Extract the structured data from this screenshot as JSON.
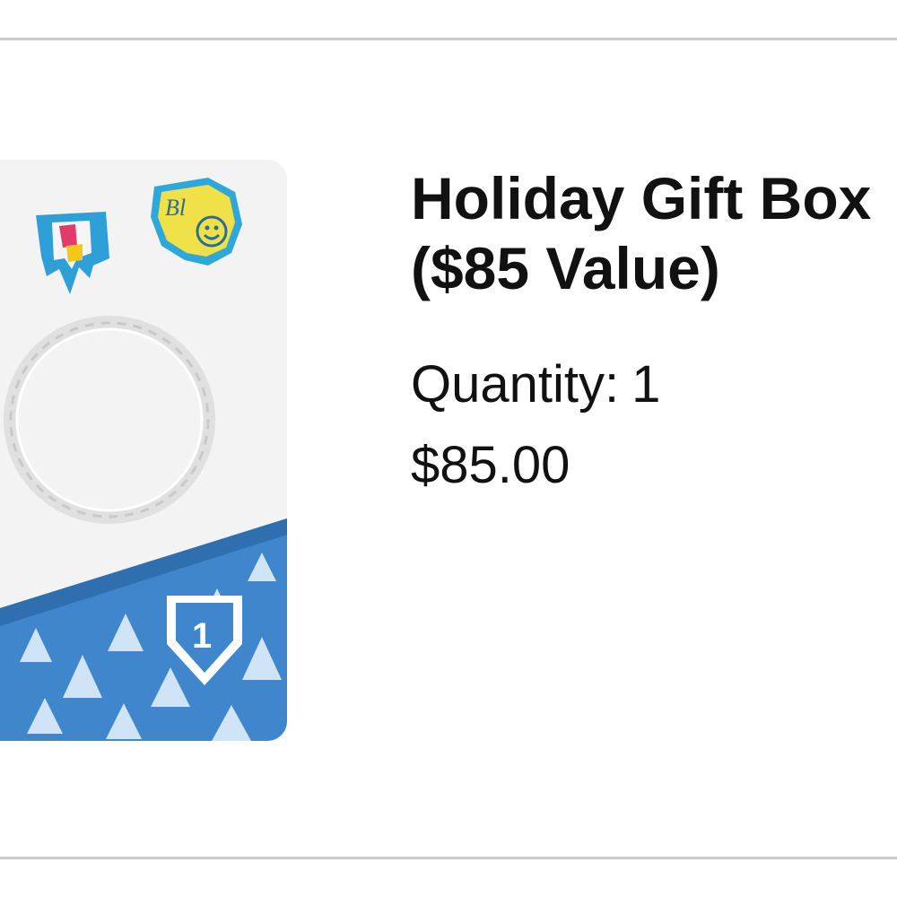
{
  "item": {
    "title_line1": "Holiday Gift Box",
    "title_line2": "($85 Value)",
    "quantity_label": "Quantity:",
    "quantity_value": "1",
    "price": "$85.00",
    "image_icon": "product-photo"
  },
  "colors": {
    "divider": "#c9c9c9",
    "text": "#111111",
    "box_blue": "#3f86cc",
    "tree_light": "#cfe4f6"
  }
}
